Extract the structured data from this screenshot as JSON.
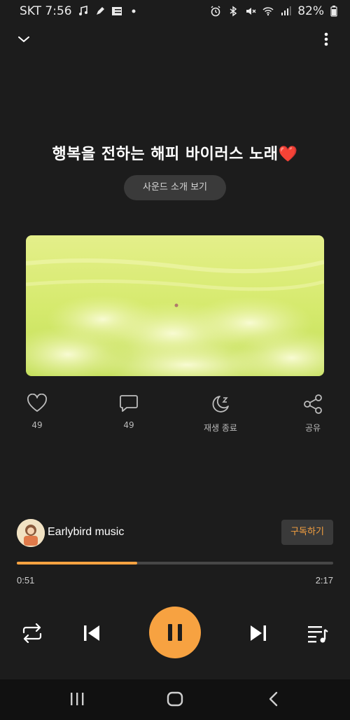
{
  "status_bar": {
    "carrier_time": "SKT 7:56",
    "battery": "82%",
    "left_icons": [
      "music-note-icon",
      "pen-icon",
      "list-icon",
      "dot-icon"
    ],
    "right_icons": [
      "alarm-icon",
      "bluetooth-icon",
      "mute-icon",
      "wifi-icon",
      "signal-icon",
      "battery-icon"
    ]
  },
  "header": {
    "collapse_icon": "chevron-down-icon",
    "more_icon": "more-vertical-icon"
  },
  "track": {
    "title": "행복을 전하는 해피 바이러스 노래❤️",
    "intro_button": "사운드 소개 보기"
  },
  "actions": [
    {
      "icon": "heart-icon",
      "label": "49"
    },
    {
      "icon": "comment-icon",
      "label": "49"
    },
    {
      "icon": "sleep-timer-icon",
      "label": "재생 종료"
    },
    {
      "icon": "share-icon",
      "label": "공유"
    }
  ],
  "channel": {
    "name": "Earlybird music",
    "subscribe_label": "구독하기"
  },
  "player": {
    "progress_fraction": 0.38,
    "time_current": "0:51",
    "time_total": "2:17"
  },
  "colors": {
    "accent": "#f7a241",
    "background": "#1c1c1c",
    "pill": "#3a3a3a"
  }
}
